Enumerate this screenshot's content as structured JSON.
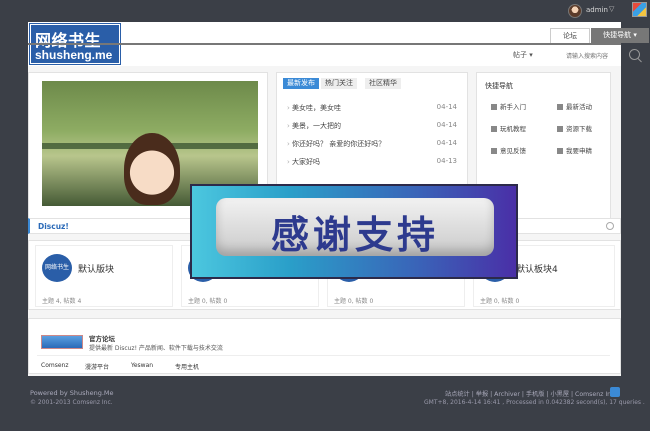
{
  "topbar": {
    "username": "admin",
    "caret": "▽"
  },
  "header": {
    "logo_cn": "网络书生",
    "logo_en": "shusheng.me",
    "tab_forum": "论坛",
    "tab_quick": "快捷导航 ▾",
    "search_type": "帖子 ▾",
    "search_placeholder": "请输入搜索内容"
  },
  "news": {
    "tabs": [
      "最新发布",
      "热门关注",
      "社区精华"
    ],
    "items": [
      {
        "title": "美女哇，美女哇",
        "date": "04-14"
      },
      {
        "title": "美景，一大把的",
        "date": "04-14"
      },
      {
        "title": "你还好吗？ 亲爱的你还好吗？",
        "date": "04-14"
      },
      {
        "title": "大家好吗",
        "date": "04-13"
      }
    ]
  },
  "quick": {
    "title": "快捷导航",
    "items": [
      "新手入门",
      "最新活动",
      "玩机教程",
      "资源下载",
      "意见反馈",
      "我要申精"
    ]
  },
  "section": {
    "title": "Discuz!"
  },
  "forums": [
    {
      "logo": "网络书生",
      "name": "默认版块",
      "stats": "主题 4, 帖数 4"
    },
    {
      "logo": "",
      "name": "",
      "stats": "主题 0, 帖数 0"
    },
    {
      "logo": "",
      "name": "",
      "stats": "主题 0, 帖数 0"
    },
    {
      "logo": "",
      "name": "默认板块4",
      "stats": "主题 0, 帖数 0"
    }
  ],
  "links": {
    "official_title": "官方论坛",
    "official_desc": "提供最新 Discuz! 产品新闻、软件下载与技术交流",
    "friends": [
      "Comsenz",
      "漫游平台",
      "Yeswan",
      "专用主机"
    ]
  },
  "footer": {
    "powered": "Powered by Shusheng.Me",
    "copyright": "© 2001-2013 Comsenz Inc.",
    "links": "站点统计 | 举报 | Archiver | 手机版 | 小黑屋 | Comsenz Inc.",
    "info": "GMT+8, 2016-4-14 16:41 , Processed in 0.042382 second(s), 17 queries ."
  },
  "overlay": {
    "text": "感谢支持"
  }
}
